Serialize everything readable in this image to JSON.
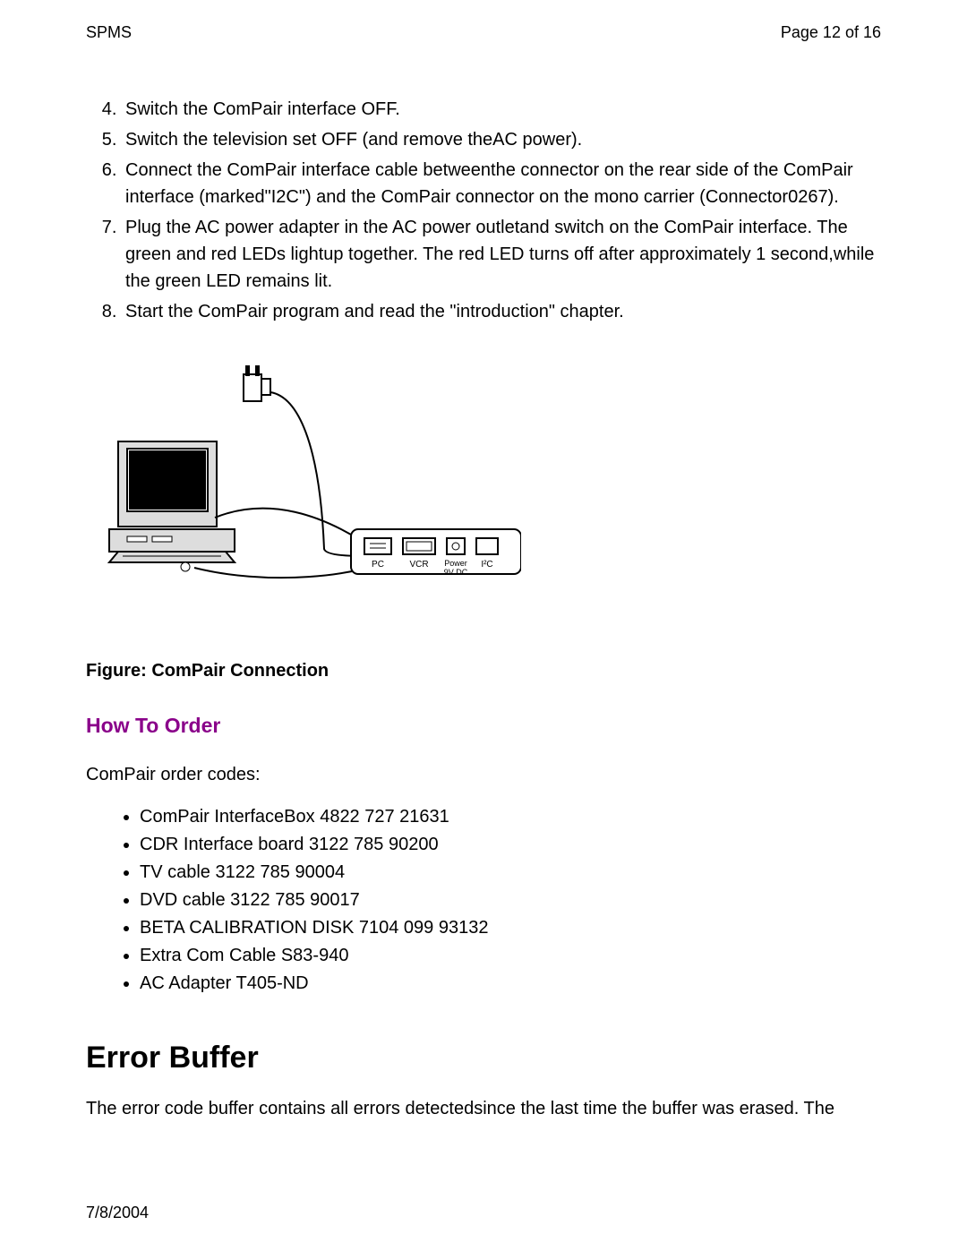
{
  "header": {
    "left": "SPMS",
    "right": "Page 12 of 16"
  },
  "steps": {
    "start": 4,
    "items": [
      "Switch the ComPair interface OFF.",
      "Switch the television set OFF (and remove theAC power).",
      "Connect the ComPair interface cable betweenthe connector on the rear side of the ComPair interface (marked\"I2C\") and the ComPair connector on the mono carrier (Connector0267).",
      "Plug the AC power adapter in the AC power outletand switch on the ComPair interface. The green and red LEDs lightup together. The red LED turns off after approximately 1 second,while the green LED remains lit.",
      "Start the ComPair program and read the \"introduction\" chapter."
    ]
  },
  "figure": {
    "caption": "Figure: ComPair Connection",
    "labels": {
      "pc": "PC",
      "vcr": "VCR",
      "power": "Power",
      "volts": "9V DC",
      "i2c": "I²C"
    }
  },
  "howToOrder": {
    "heading": "How To Order",
    "intro": "ComPair order codes:",
    "items": [
      "ComPair InterfaceBox 4822 727 21631",
      "CDR Interface board 3122 785 90200",
      "TV cable 3122 785 90004",
      "DVD cable 3122 785 90017",
      "BETA CALIBRATION DISK 7104 099 93132",
      "Extra Com Cable S83-940",
      "AC Adapter T405-ND"
    ]
  },
  "errorBuffer": {
    "heading": "Error Buffer",
    "body": "The error code buffer contains all errors detectedsince the last time the buffer was erased. The"
  },
  "footer": {
    "date": "7/8/2004"
  }
}
